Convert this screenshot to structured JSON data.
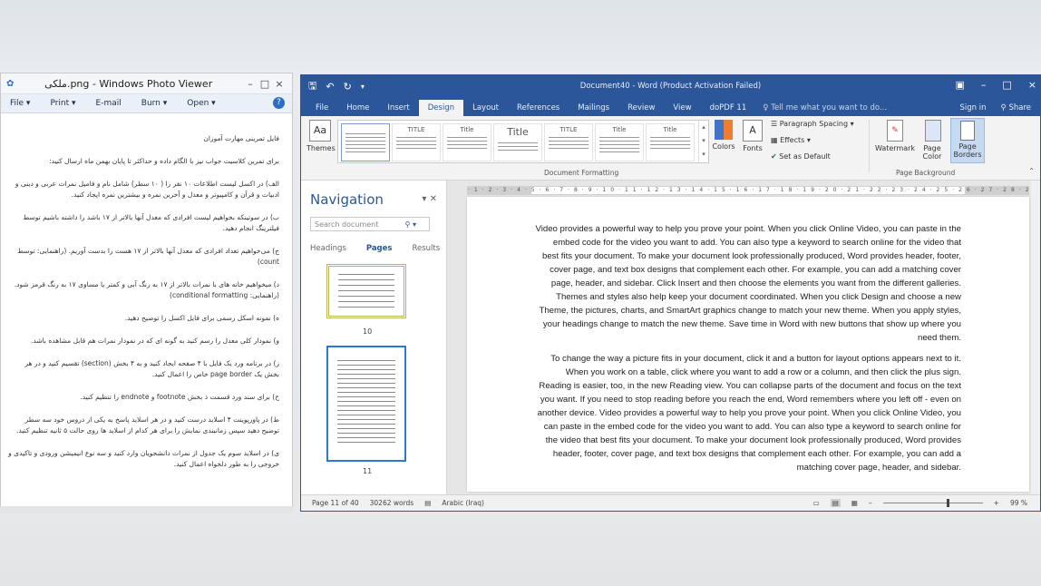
{
  "photo_viewer": {
    "title": "ملکی.png - Windows Photo Viewer",
    "controls": [
      "–",
      "□",
      "×"
    ],
    "menu": [
      "File ▾",
      "Print ▾",
      "E-mail",
      "Burn ▾",
      "Open ▾"
    ],
    "help_icon": "help-icon",
    "lines": [
      "فایل تمرینی مهارت آموزان",
      "برای تمرین کلاسیت جواب نیز با الگام داده و حداکثر تا پایان بهمن ماه ارسال کنید:",
      "الف) در اکسل لیست اطلاعات ۱۰ نفر را ( ۱۰ سطر) شامل نام و فامیل نمرات عربی و دینی و ادبیات و قرآن و کامپیوتر و معدل و آخرین نمره و بیشترین نمره ایجاد کنید.",
      "ب) در سوتینکه بخواهیم لیست افرادی که معدل آنها بالاتر از ۱۷ باشد را داشته باشیم توسط فیلترینگ انجام دهید.",
      "ج) می‌خواهیم تعداد افرادی که معدل آنها بالاتر از ۱۷ هست را بدست آوریم. (راهنمایی: توسط count)",
      "د) میخواهیم خانه های با نمرات بالاتر از ۱۷ به رنگ آبی و کمتر یا مساوی ۱۷ به رنگ قرمز شود. (راهنمایی: conditional formatting)",
      "ه) نمونه اسکل رسمی برای فایل اکسل را توضیح دهید.",
      "و) نمودار کلی معدل را رسم کنید به گونه ای که در نمودار نمرات هم قابل مشاهده باشد.",
      "ز) در برنامه ورد یک فایل با ۴ صفحه ایجاد کنید و به ۴ بخش (section) تقسیم کنید و در هر بخش یک page border خاص را اعمال کنید.",
      "ح) برای سند ورد قسمت ذ بخش footnote و endnote را تنظیم کنید.",
      "ط) در پاورپوینت ۴ اسلاید درست کنید و در هر اسلاید پاسخ به یکی از دروس خود سه سطر توضیح دهید سپس زمانبندی نمایش را برای هر کدام از اسلاید ها روی حالت ۵ ثانیه تنظیم کنید.",
      "ی) در اسلاید سوم یک جدول از نمرات دانشجویان وارد کنید و سه نوع انیمیشن ورودی و تاکیدی و خروجی را به طور دلخواه اعمال کنید."
    ]
  },
  "word": {
    "qat_icons": [
      "save-icon",
      "undo-icon",
      "redo-icon",
      "customize-icon"
    ],
    "title": "Document40 - Word (Product Activation Failed)",
    "window_controls": [
      "▣",
      "–",
      "□",
      "×"
    ],
    "tabs": [
      "File",
      "Home",
      "Insert",
      "Design",
      "Layout",
      "References",
      "Mailings",
      "Review",
      "View",
      "doPDF 11"
    ],
    "active_tab": "Design",
    "tell_me": "♀ Tell me what you want to do...",
    "sign_in": "Sign in",
    "share": "Share",
    "ribbon": {
      "themes": "Themes",
      "gallery_titles": [
        "",
        "TITLE",
        "Title",
        "Title",
        "TITLE",
        "Title",
        "Title"
      ],
      "colors": "Colors",
      "fonts": "Fonts",
      "paragraph_spacing": "Paragraph Spacing",
      "effects": "Effects",
      "set_default": "Set as Default",
      "group_doc_formatting": "Document Formatting",
      "watermark": "Watermark",
      "page_color": "Page Color",
      "page_borders": "Page Borders",
      "group_page_background": "Page Background"
    },
    "nav": {
      "title": "Navigation",
      "search_placeholder": "Search document",
      "tabs": [
        "Headings",
        "Pages",
        "Results"
      ],
      "active_tab": "Pages",
      "page_numbers": [
        "10",
        "11"
      ]
    },
    "document": {
      "paragraphs": [
        "Video provides a powerful way to help you prove your point. When you click Online Video, you can paste in the embed code for the video you want to add. You can also type a keyword to search online for the video that best fits your document. To make your document look professionally produced, Word provides header, footer, cover page, and text box designs that complement each other. For example, you can add a matching cover page, header, and sidebar. Click Insert and then choose the elements you want from the different galleries. Themes and styles also help keep your document coordinated. When you click Design and choose a new Theme, the pictures, charts, and SmartArt graphics change to match your new theme. When you apply styles, your headings change to match the new theme. Save time in Word with new buttons that show up where you need them.",
        "To change the way a picture fits in your document, click it and a button for layout options appears next to it. When you work on a table, click where you want to add a row or a column, and then click the plus sign. Reading is easier, too, in the new Reading view. You can collapse parts of the document and focus on the text you want. If you need to stop reading before you reach the end, Word remembers where you left off - even on another device. Video provides a powerful way to help you prove your point. When you click Online Video, you can paste in the embed code for the video you want to add. You can also type a keyword to search online for the video that best fits your document. To make your document look professionally produced, Word provides header, footer, cover page, and text box designs that complement each other. For example, you can add a matching cover page, header, and sidebar."
      ]
    },
    "status": {
      "page": "Page 11 of 40",
      "words": "30262 words",
      "language": "Arabic (Iraq)",
      "zoom": "99 %"
    }
  }
}
